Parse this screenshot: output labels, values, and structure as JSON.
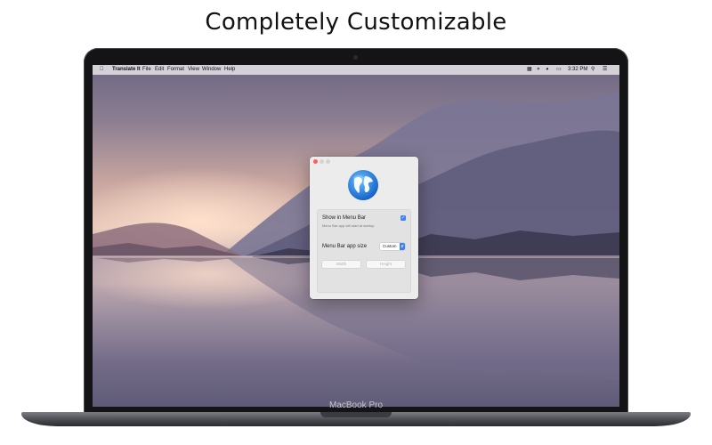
{
  "headline": "Completely Customizable",
  "laptop": {
    "brand": "MacBook Pro"
  },
  "menubar": {
    "app_name": "Translate It",
    "items": [
      "File",
      "Edit",
      "Format",
      "View",
      "Window",
      "Help"
    ],
    "time": "3:32 PM"
  },
  "app_window": {
    "icon": "globe-icon",
    "show_in_menu_bar_label": "Show in Menu Bar",
    "show_in_menu_bar_checked": true,
    "show_in_menu_bar_hint": "Menu Bar app will start at startup",
    "menu_bar_app_size_label": "Menu Bar app size",
    "menu_bar_app_size_value": "Custom",
    "width_placeholder": "Width",
    "height_placeholder": "Height"
  },
  "colors": {
    "accent": "#3b82f6"
  }
}
